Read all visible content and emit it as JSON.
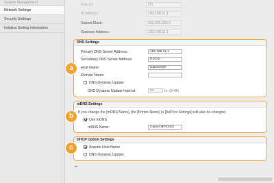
{
  "sidebar": {
    "items": [
      {
        "label": "System Management"
      },
      {
        "label": "Network Settings"
      },
      {
        "label": "Security Settings"
      },
      {
        "label": "Initialize Setting Information"
      }
    ]
  },
  "top_fields": {
    "auto_label": "Auto (0)",
    "auto_value": "On",
    "ip_label": "IP Address:",
    "ip_value": "192.168.11.1",
    "subnet_label": "Subnet Mask:",
    "subnet_value": "255.255.255.0",
    "gateway_label": "Gateway Address:",
    "gateway_value": "192.168.11.1"
  },
  "dns": {
    "title": "DNS Settings",
    "primary_label": "Primary DNS Server Address:",
    "primary_value": "192.168.11.1",
    "secondary_label": "Secondary DNS Server Address:",
    "secondary_value": "0.0.0.0",
    "host_label": "Host Name:",
    "host_value": "CanonXXX",
    "domain_label": "Domain Name:",
    "domain_value": "",
    "dynamic_update_label": "DNS Dynamic Update",
    "dynamic_update_checked": false,
    "interval_label": "DNS Dynamic Update Interval:",
    "interval_value": "24",
    "interval_unit": "hr. (0-48)",
    "badge": "a"
  },
  "mdns": {
    "title": "mDNS Settings",
    "note": "If you change the [mDNS Name], the [Printer Name] in [AirPrint Settings] will also be changed.",
    "use_label": "Use mDNS",
    "use_checked": true,
    "name_label": "mDNS Name:",
    "name_value": "Canon MFXXXX",
    "badge": "b"
  },
  "dhcp": {
    "title": "DHCP Option Settings",
    "acquire_label": "Acquire Host Name",
    "acquire_checked": true,
    "dynamic_label": "DNS Dynamic Update",
    "dynamic_checked": false,
    "badge": "c"
  },
  "colors": {
    "accent": "#f2a22e"
  }
}
